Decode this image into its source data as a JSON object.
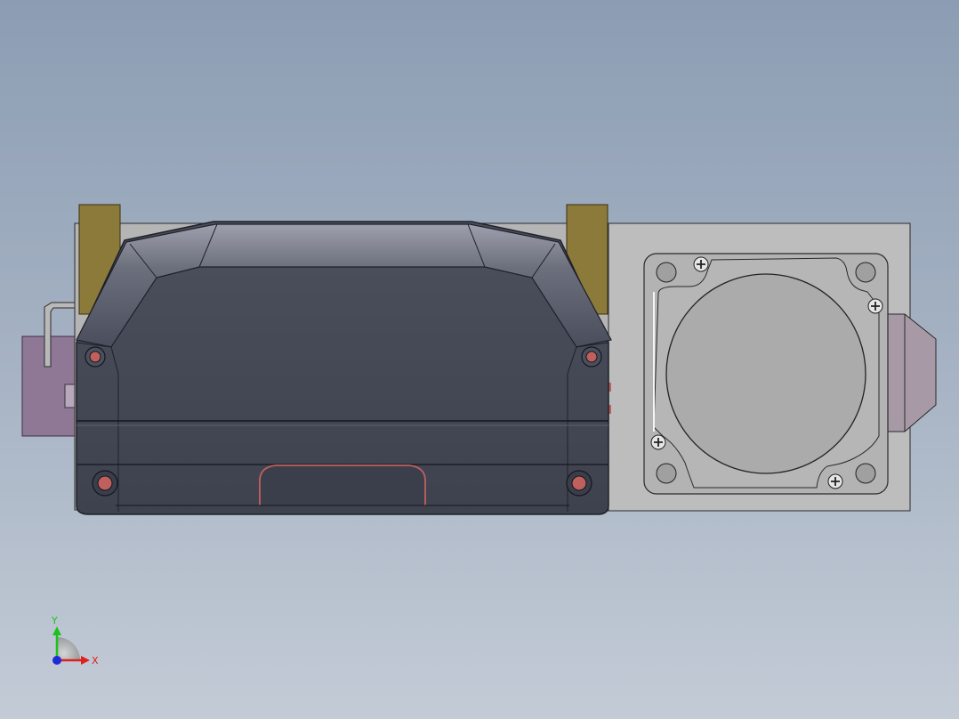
{
  "viewport": {
    "background_top": "#8c9db3",
    "background_bottom": "#c3cbd6"
  },
  "colors": {
    "housing_dark": "#454a57",
    "housing_edge": "#1e2129",
    "plate_gray": "#b9b9b9",
    "bracket_olive": "#8c7a3a",
    "connector_purple": "#8e7895",
    "accent_red": "#c0605e",
    "motor_face": "#a9a9a9",
    "axis_x": "#e0201b",
    "axis_y": "#1cc21c",
    "axis_z": "#1e2ad8"
  },
  "model": {
    "components": [
      {
        "name": "handheld-pendant-housing",
        "icon": "pendant-housing-icon"
      },
      {
        "name": "mounting-plate",
        "icon": "plate-icon"
      },
      {
        "name": "servo-motor-flange",
        "icon": "motor-flange-icon"
      },
      {
        "name": "left-bracket",
        "icon": "bracket-icon"
      },
      {
        "name": "right-bracket",
        "icon": "bracket-icon"
      },
      {
        "name": "cable-connector",
        "icon": "connector-icon"
      }
    ]
  },
  "triad": {
    "x_label": "X",
    "y_label": "Y"
  }
}
